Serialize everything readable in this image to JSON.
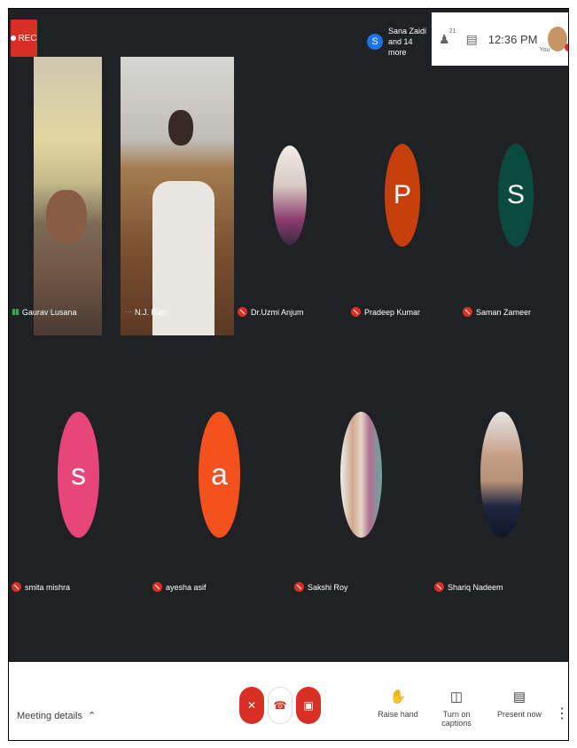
{
  "top": {
    "rec_label": "REC",
    "participants_initial": "S",
    "participants_line1": "Sana Zaidi",
    "participants_line2": "and 14 more",
    "people_count": "21",
    "clock": "12:36 PM",
    "you_label": "You"
  },
  "tiles": [
    {
      "name": "Gaurav Lusana",
      "type": "video"
    },
    {
      "name": "N.J. Rao",
      "type": "video"
    },
    {
      "name": "Dr.Uzmi Anjum",
      "type": "photo"
    },
    {
      "name": "Pradeep Kumar",
      "initial": "P",
      "color": "#c6400e"
    },
    {
      "name": "Saman Zameer",
      "initial": "S",
      "color": "#0b4a3f"
    },
    {
      "name": "smita mishra",
      "initial": "s",
      "color": "#e8467a"
    },
    {
      "name": "ayesha asif",
      "initial": "a",
      "color": "#f4511e"
    },
    {
      "name": "Sakshi Roy",
      "type": "photo"
    },
    {
      "name": "Shariq Nadeem",
      "type": "photo"
    }
  ],
  "controls": {
    "meeting_details": "Meeting details",
    "raise_hand": "Raise hand",
    "captions": "Turn on captions",
    "present": "Present now"
  },
  "colors": {
    "muted_red": "#d93025",
    "background": "#202124",
    "accent_blue": "#1a73e8"
  }
}
